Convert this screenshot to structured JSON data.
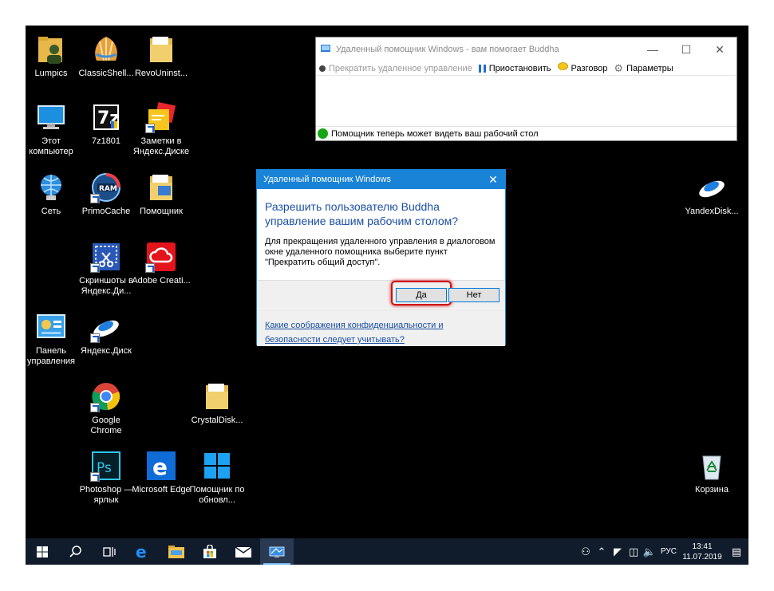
{
  "desktop": {
    "icons": [
      {
        "label": "Lumpics"
      },
      {
        "label": "ClassicShell..."
      },
      {
        "label": "RevoUninst..."
      },
      {
        "label": "Этот компьютер"
      },
      {
        "label": "7z1801"
      },
      {
        "label": "Заметки в Яндекс.Диске"
      },
      {
        "label": "Сеть"
      },
      {
        "label": "PrimoCache"
      },
      {
        "label": "Помощник"
      },
      {
        "label": "YandexDisk..."
      },
      {
        "label": "Скриншоты в Яндекс.Ди..."
      },
      {
        "label": "Adobe Creati..."
      },
      {
        "label": "Панель управления"
      },
      {
        "label": "Яндекс.Диск"
      },
      {
        "label": "Google Chrome"
      },
      {
        "label": "CrystalDisk..."
      },
      {
        "label": "Photoshop — ярлык"
      },
      {
        "label": "Microsoft Edge"
      },
      {
        "label": "Помощник по обновл..."
      },
      {
        "label": "Корзина"
      }
    ]
  },
  "ra_window": {
    "title": "Удаленный помощник Windows - вам помогает Buddha",
    "toolbar": {
      "stop": "Прекратить удаленное управление",
      "pause": "Приостановить",
      "chat": "Разговор",
      "settings": "Параметры"
    },
    "status": "Помощник теперь может видеть ваш рабочий стол"
  },
  "dialog": {
    "title": "Удаленный помощник Windows",
    "heading": "Разрешить пользователю Buddha управление вашим рабочим столом?",
    "body": "Для прекращения удаленного управления в диалоговом окне удаленного помощника выберите пункт \"Прекратить общий доступ\".",
    "yes": "Да",
    "no": "Нет",
    "link": "Какие соображения конфиденциальности и безопасности следует учитывать?"
  },
  "taskbar": {
    "lang": "РУС",
    "time": "13:41",
    "date": "11.07.2019"
  },
  "colors": {
    "accent": "#1883d7",
    "taskbar": "#101c2c",
    "highlight": "#d01010",
    "status_green": "#16a516"
  }
}
